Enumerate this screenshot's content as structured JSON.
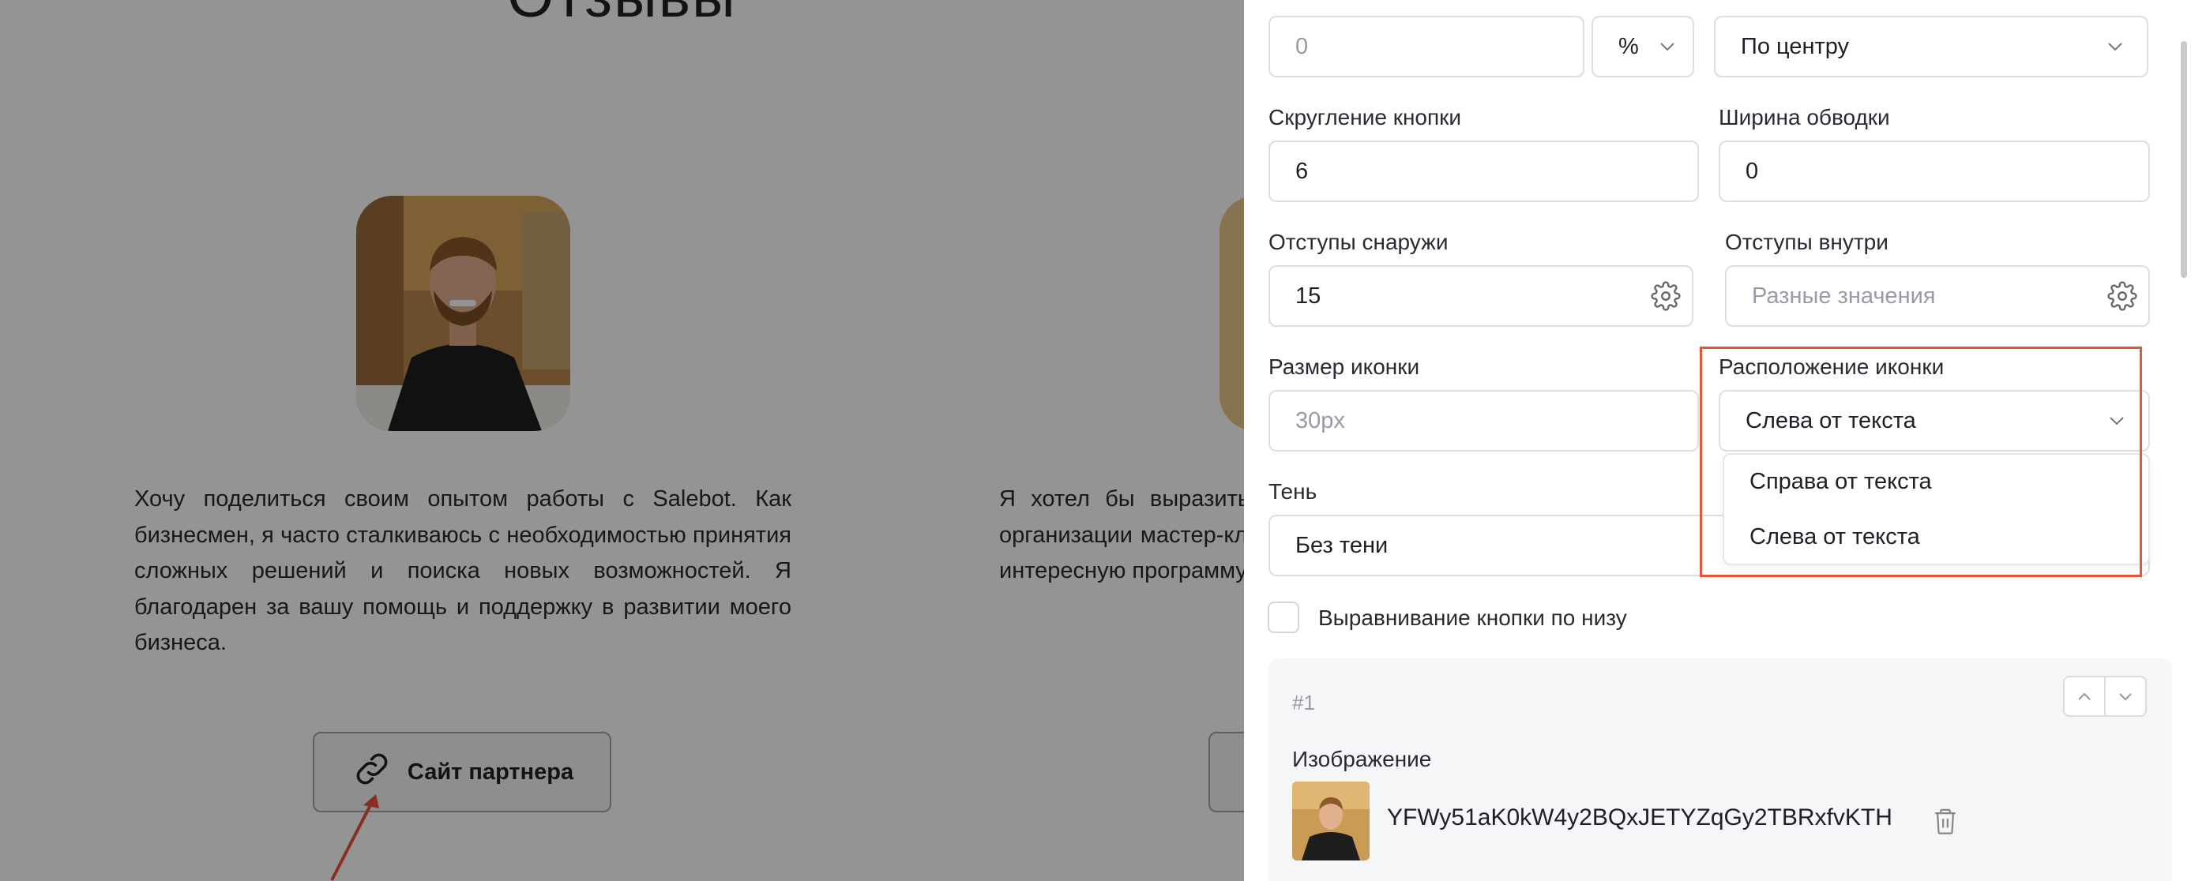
{
  "page": {
    "title": "Отзывы",
    "review_1": "Хочу поделиться своим опытом работы с Salebot. Как бизнесмен, я часто сталкиваюсь с необходимостью принятия сложных решений и поиска новых возможностей. Я благодарен за вашу помощь и поддержку в развитии моего бизнеса.",
    "review_2": "Я хотел бы выразить благодарность за вашу помощь в организации мастер-класса по фитнесу. Вы помогли создать интересную программу для участников.",
    "partner_button": "Сайт партнера",
    "link_icon": "link-icon"
  },
  "panel": {
    "width_input": {
      "value": "0"
    },
    "unit_select": {
      "value": "%"
    },
    "align_select": {
      "value": "По центру"
    },
    "radius": {
      "label": "Скругление кнопки",
      "value": "6"
    },
    "border_width": {
      "label": "Ширина обводки",
      "value": "0"
    },
    "outer_padding": {
      "label": "Отступы снаружи",
      "value": "15"
    },
    "inner_padding": {
      "label": "Отступы внутри",
      "placeholder": "Разные значения"
    },
    "icon_size": {
      "label": "Размер иконки",
      "placeholder": "30px"
    },
    "icon_position": {
      "label": "Расположение иконки",
      "value": "Слева от текста",
      "options": [
        "Справа от текста",
        "Слева от текста"
      ]
    },
    "shadow": {
      "label": "Тень",
      "value": "Без тени"
    },
    "bottom_align": {
      "label": "Выравнивание кнопки по низу",
      "checked": false
    },
    "item": {
      "number": "#1",
      "image_label": "Изображение",
      "file_name": "YFWy51aK0kW4y2BQxJETYZqGy2TBRxfvKTH"
    }
  },
  "colors": {
    "highlight": "#e8533a",
    "overlay": "rgba(0,0,0,0.42)"
  }
}
